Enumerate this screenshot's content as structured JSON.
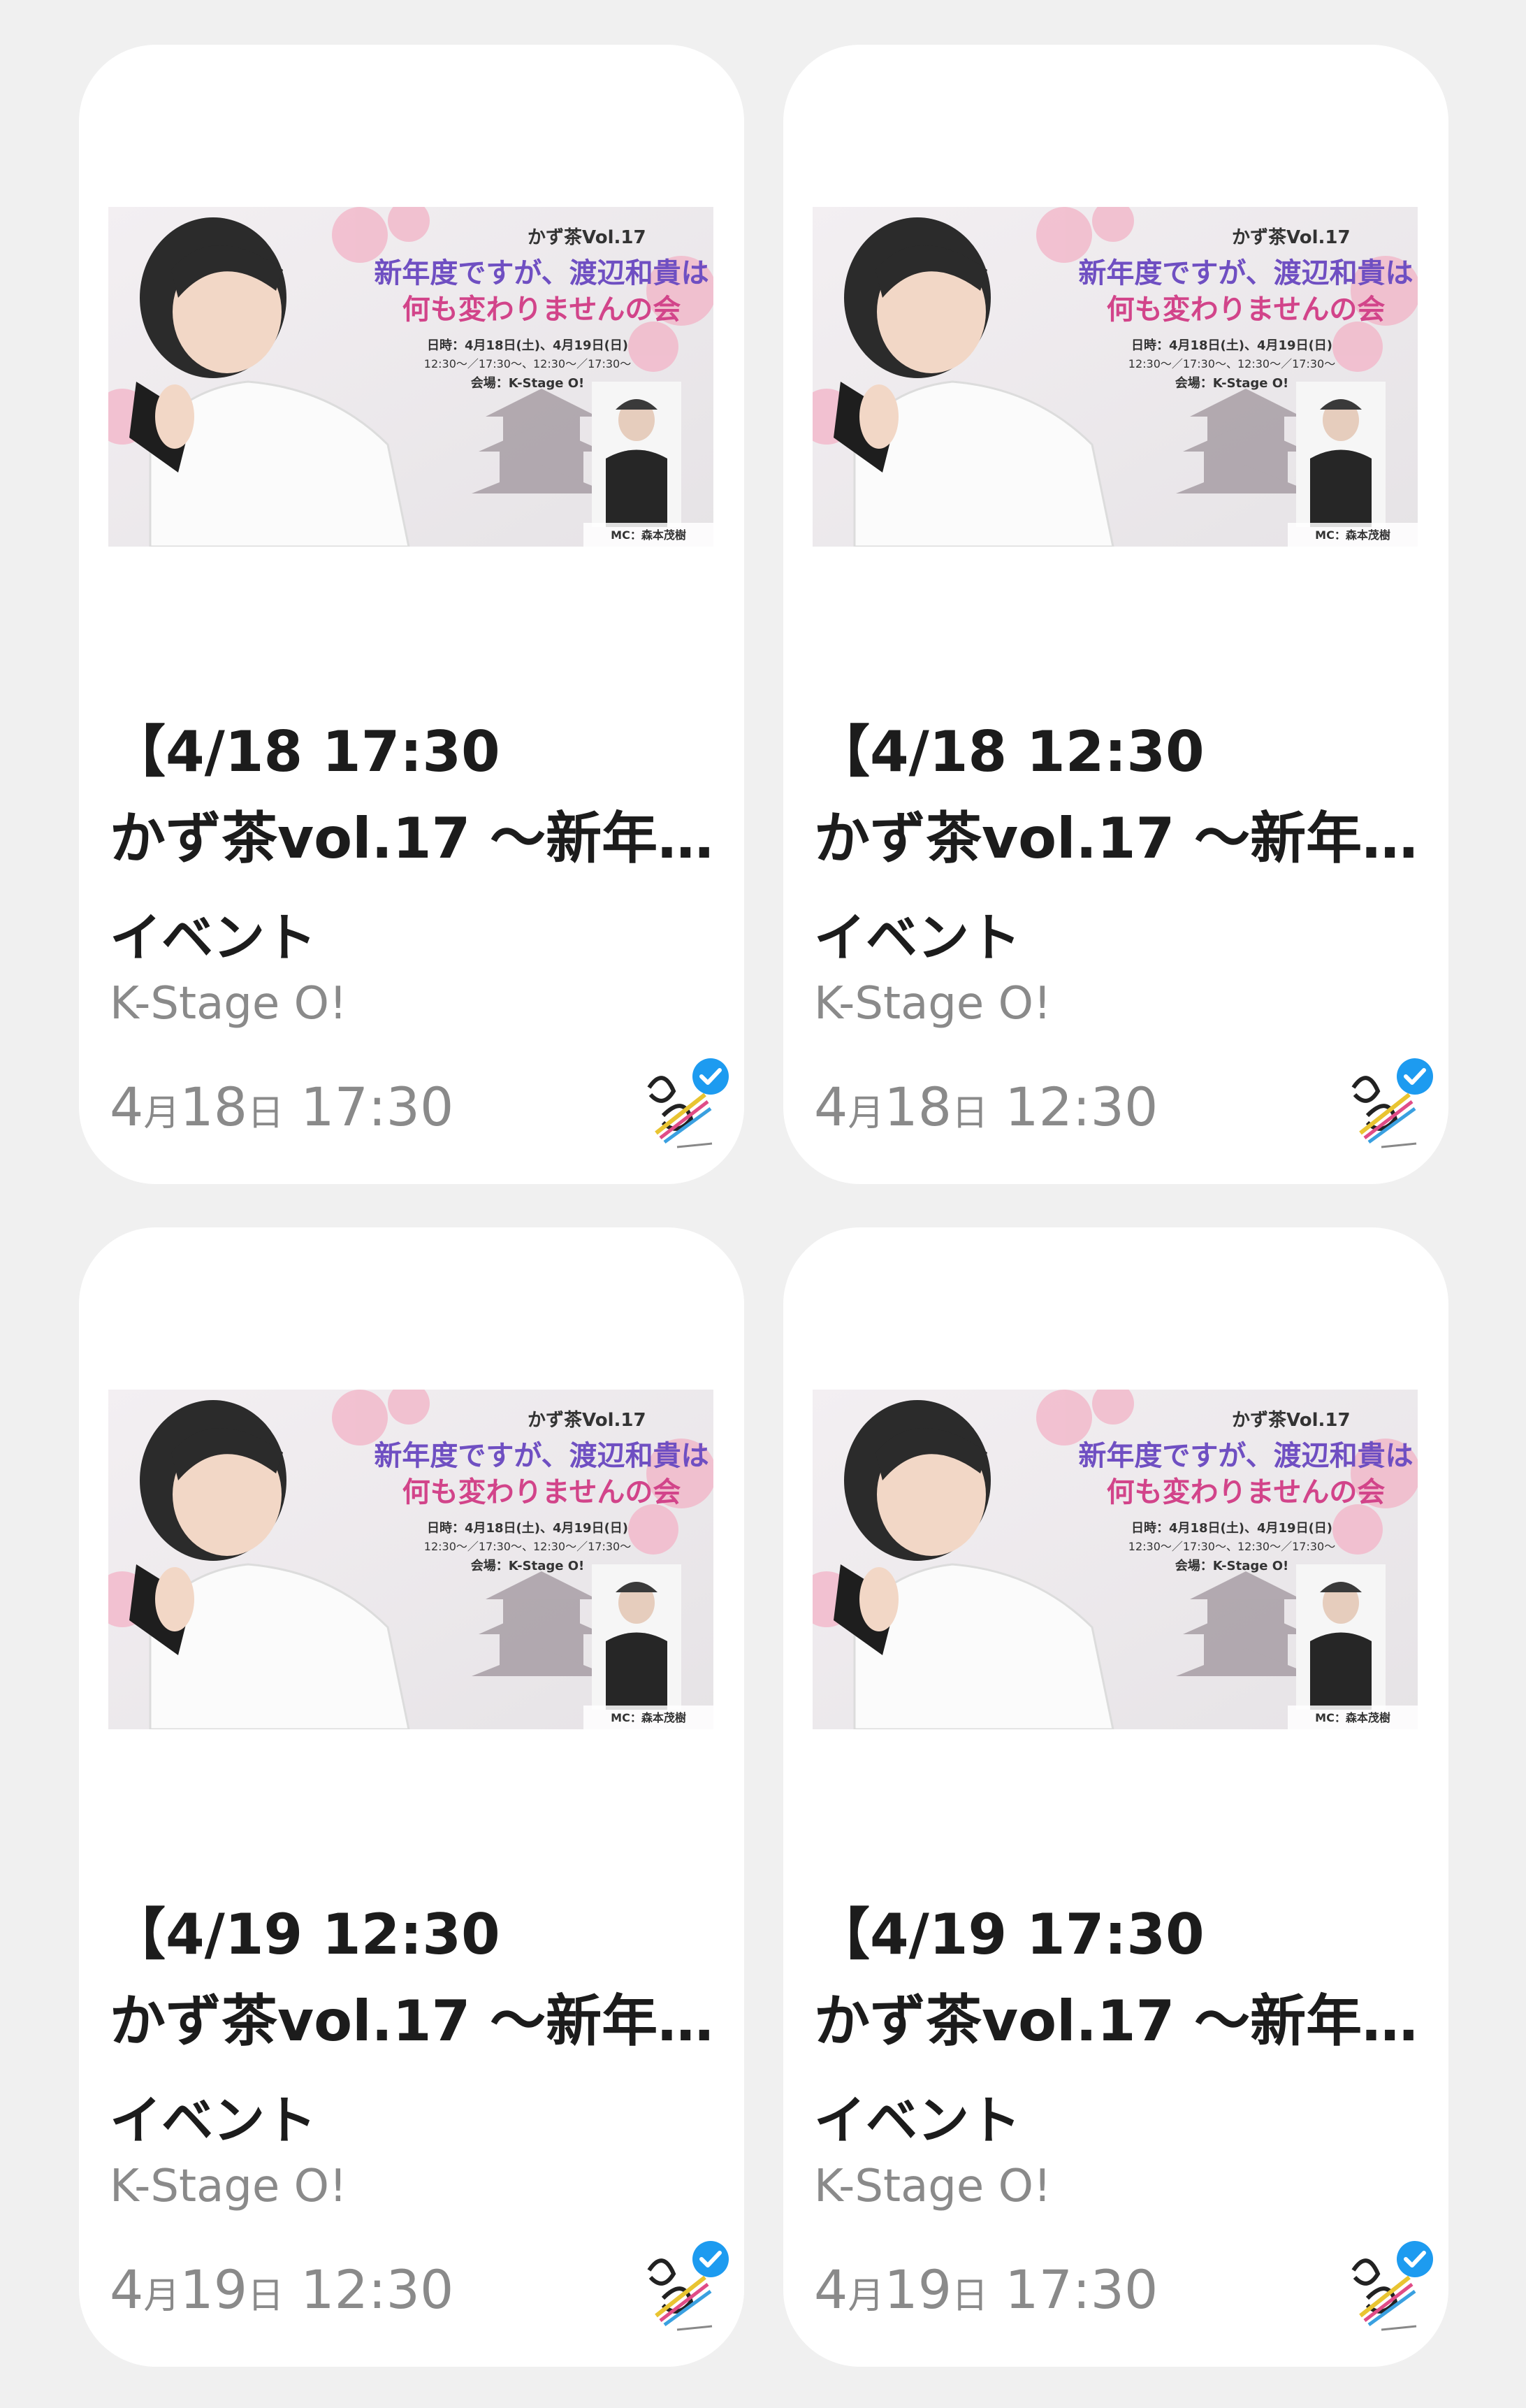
{
  "cards": [
    {
      "title_line1": "【4/18 17:30",
      "title_line2": "かず茶vol.17 〜新年…",
      "category": "イベント",
      "venue": "K-Stage O!",
      "date_month": "4",
      "date_month_unit": "月",
      "date_day": "18",
      "date_day_unit": "日",
      "date_time": "17:30"
    },
    {
      "title_line1": "【4/18 12:30",
      "title_line2": "かず茶vol.17 〜新年…",
      "category": "イベント",
      "venue": "K-Stage O!",
      "date_month": "4",
      "date_month_unit": "月",
      "date_day": "18",
      "date_day_unit": "日",
      "date_time": "12:30"
    },
    {
      "title_line1": "【4/19 12:30",
      "title_line2": "かず茶vol.17 〜新年…",
      "category": "イベント",
      "venue": "K-Stage O!",
      "date_month": "4",
      "date_month_unit": "月",
      "date_day": "19",
      "date_day_unit": "日",
      "date_time": "12:30"
    },
    {
      "title_line1": "【4/19 17:30",
      "title_line2": "かず茶vol.17 〜新年…",
      "category": "イベント",
      "venue": "K-Stage O!",
      "date_month": "4",
      "date_month_unit": "月",
      "date_day": "19",
      "date_day_unit": "日",
      "date_time": "17:30"
    }
  ],
  "banner": {
    "series": "かず茶Vol.17",
    "headline1": "新年度ですが、渡辺和貴は",
    "headline2": "何も変わりませんの会",
    "schedule": "日時：4月18日(土)、4月19日(日)",
    "times": "12:30〜／17:30〜、12:30〜／17:30〜",
    "venue": "会場：K-Stage O!",
    "mc": "MC：森本茂樹"
  },
  "icons": {
    "logo": "one-stroke-logo-icon",
    "verified": "verified-badge-icon"
  },
  "colors": {
    "background": "#f0f0f0",
    "card": "#ffffff",
    "title": "#1c1c1c",
    "muted": "#8a8a8a",
    "verified": "#1d9bf0"
  }
}
